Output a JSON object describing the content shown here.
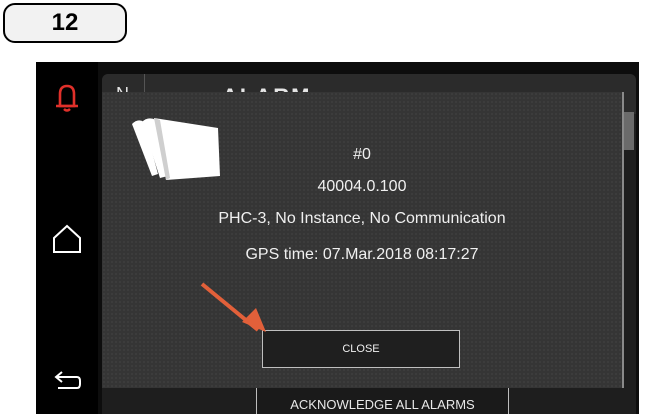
{
  "step": {
    "number": "12"
  },
  "background_screen": {
    "n_label": "N",
    "title": "ALARM",
    "acknowledge_label": "ACKNOWLEDGE ALL ALARMS"
  },
  "sidebar": {
    "items": [
      {
        "icon": "bell-alarm-icon",
        "color": "#e0302a"
      },
      {
        "icon": "home-icon",
        "color": "#ffffff"
      },
      {
        "icon": "back-arrow-icon",
        "color": "#ffffff"
      }
    ]
  },
  "dialog": {
    "icon": "document-stack-icon",
    "alarm_number": "#0",
    "code": "40004.0.100",
    "description": "PHC-3, No Instance, No Communication",
    "gps_time": "GPS time: 07.Mar.2018 08:17:27",
    "close_label": "CLOSE"
  },
  "pointer": {
    "color": "#e2603a"
  }
}
